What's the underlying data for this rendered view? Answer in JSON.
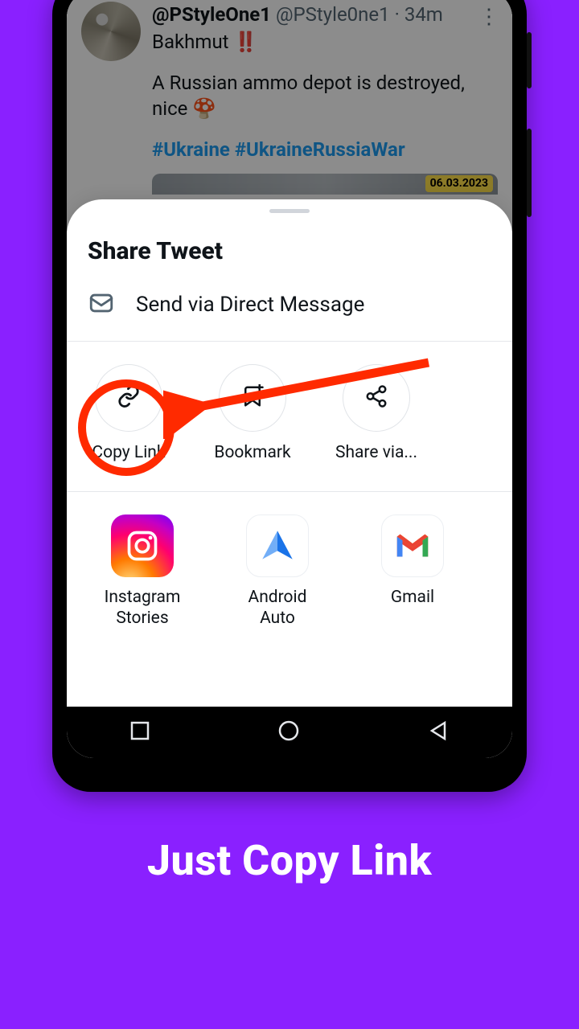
{
  "caption": "Just Copy Link",
  "tweet": {
    "handle_bold": "@PStyleOne1",
    "handle_gray": "@PStyle0ne1",
    "time_sep": " · ",
    "time": "34m",
    "line1_text": "Bakhmut ",
    "line1_emoji": "‼️",
    "line2": "A Russian ammo depot is destroyed, nice 🍄",
    "hashtag1": "#Ukraine",
    "hashtag2": "#UkraineRussiaWar",
    "date_badge": "06.03.2023"
  },
  "sheet": {
    "title": "Share Tweet",
    "dm_label": "Send via Direct Message",
    "actions": {
      "copy_link": "Copy Link",
      "bookmark": "Bookmark",
      "share_via": "Share via..."
    },
    "apps": {
      "instagram_stories": "Instagram Stories",
      "android_auto": "Android Auto",
      "gmail": "Gmail"
    }
  },
  "highlight": {
    "ring_color": "#ff2a00",
    "arrow_color": "#ff2a00"
  }
}
